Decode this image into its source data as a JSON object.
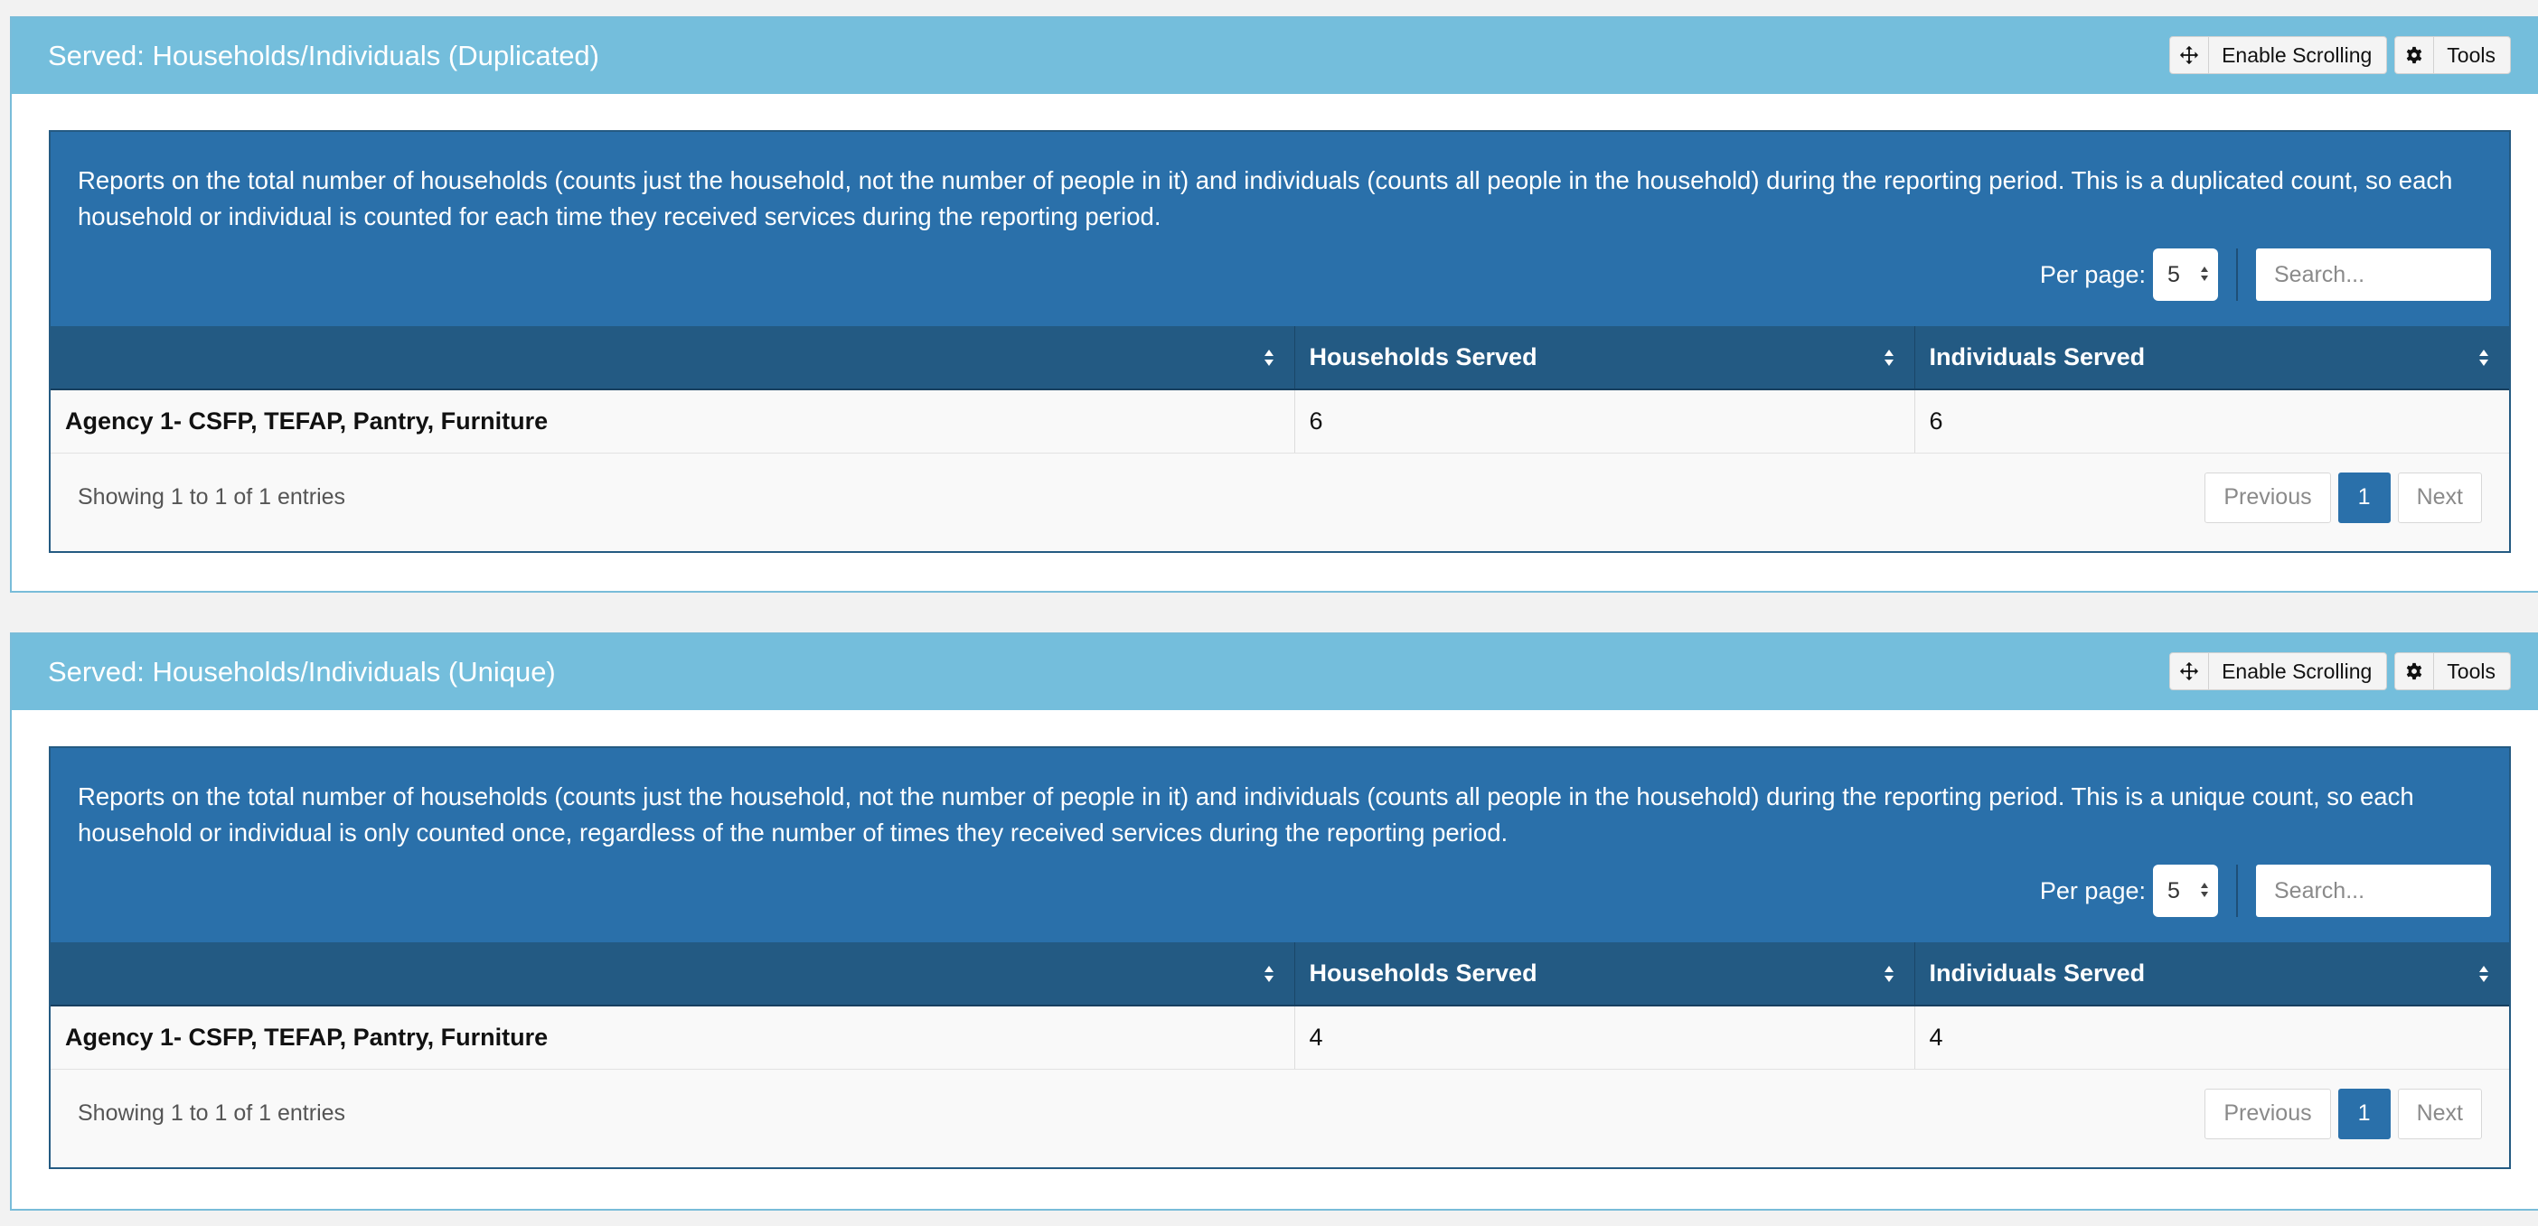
{
  "toolbar": {
    "enable_scrolling_label": "Enable Scrolling",
    "tools_label": "Tools"
  },
  "colors": {
    "panel_header": "#74bedc",
    "report_header": "#2a70aa",
    "table_header": "#235a83",
    "active_page": "#2a70aa"
  },
  "icons": {
    "scroll": "move-arrows-icon",
    "tools": "gear-icon",
    "sort": "sort-icon",
    "select": "select-arrows-icon"
  },
  "panels": [
    {
      "title": "Served: Households/Individuals (Duplicated)",
      "description": "Reports on the total number of households (counts just the household, not the number of people in it) and individuals (counts all people in the household) during the reporting period. This is a duplicated count, so each household or individual is counted for each time they received services during the reporting period.",
      "per_page_label": "Per page:",
      "per_page_value": "5",
      "search_placeholder": "Search...",
      "columns": [
        "",
        "Households Served",
        "Individuals Served"
      ],
      "rows": [
        {
          "agency": "Agency 1- CSFP, TEFAP, Pantry, Furniture",
          "households": "6",
          "individuals": "6"
        }
      ],
      "entries_info": "Showing 1 to 1 of 1 entries",
      "pagination": {
        "previous": "Previous",
        "current": "1",
        "next": "Next"
      }
    },
    {
      "title": "Served: Households/Individuals (Unique)",
      "description": "Reports on the total number of households (counts just the household, not the number of people in it) and individuals (counts all people in the household) during the reporting period. This is a unique count, so each household or individual is only counted once, regardless of the number of times they received services during the reporting period.",
      "per_page_label": "Per page:",
      "per_page_value": "5",
      "search_placeholder": "Search...",
      "columns": [
        "",
        "Households Served",
        "Individuals Served"
      ],
      "rows": [
        {
          "agency": "Agency 1- CSFP, TEFAP, Pantry, Furniture",
          "households": "4",
          "individuals": "4"
        }
      ],
      "entries_info": "Showing 1 to 1 of 1 entries",
      "pagination": {
        "previous": "Previous",
        "current": "1",
        "next": "Next"
      }
    }
  ]
}
